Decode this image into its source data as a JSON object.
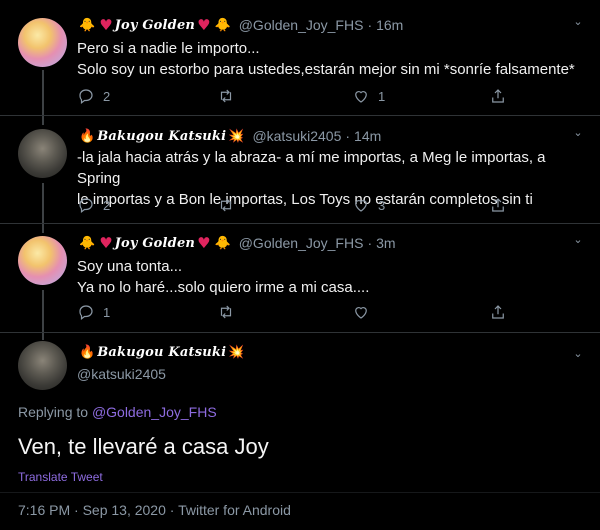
{
  "tweets": [
    {
      "display_name": "Joy Golden",
      "handle": "@Golden_Joy_FHS",
      "time": "16m",
      "lines": [
        "Pero si a nadie le importo...",
        "Solo soy un estorbo para ustedes,estarán mejor sin mi *sonríe falsamente*"
      ],
      "replies": "2",
      "retweets": "",
      "likes": "1"
    },
    {
      "display_name": "Bakugou Katsuki",
      "handle": "@katsuki2405",
      "time": "14m",
      "lines": [
        "-la jala hacia atrás y la abraza- a mí me importas, a Meg le importas, a Spring",
        "le importas y a Bon le importas, Los Toys no estarán completos sin ti"
      ],
      "replies": "2",
      "retweets": "",
      "likes": "3"
    },
    {
      "display_name": "Joy Golden",
      "handle": "@Golden_Joy_FHS",
      "time": "3m",
      "lines": [
        "Soy una tonta...",
        "Ya no lo haré...solo quiero irme a mi casa...."
      ],
      "replies": "1",
      "retweets": "",
      "likes": ""
    }
  ],
  "main": {
    "display_name": "Bakugou Katsuki",
    "handle": "@katsuki2405",
    "replying_prefix": "Replying to",
    "replying_to": "@Golden_Joy_FHS",
    "text": "Ven, te llevaré a casa Joy",
    "translate": "Translate Tweet",
    "meta": "7:16 PM · Sep 13, 2020 · Twitter for Android"
  },
  "separator": "·",
  "colors": {
    "background": "#000000",
    "link": "#8e6ce0",
    "muted": "#8b98a5",
    "heart": "#e0245e"
  },
  "icons": [
    "reply-icon",
    "retweet-icon",
    "like-icon",
    "share-icon",
    "chevron-down-icon"
  ]
}
